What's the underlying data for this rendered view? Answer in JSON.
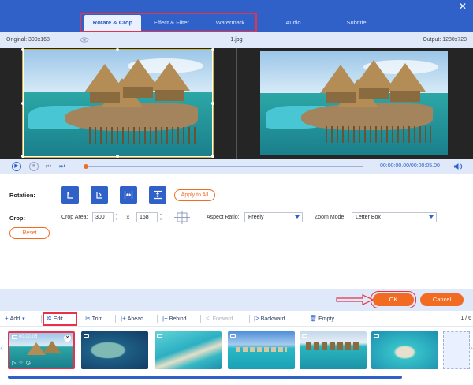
{
  "tabs": [
    {
      "label": "Rotate & Crop",
      "active": true
    },
    {
      "label": "Effect & Filter",
      "active": false
    },
    {
      "label": "Watermark",
      "active": false
    },
    {
      "label": "Audio",
      "active": false
    },
    {
      "label": "Subtitle",
      "active": false
    }
  ],
  "info": {
    "original": "Original: 300x168",
    "file_name": "1.jpg",
    "output": "Output: 1280x720"
  },
  "playback": {
    "time": "00:00:00.00/00:00:05.00"
  },
  "rotation": {
    "label": "Rotation:",
    "apply_all": "Apply to All"
  },
  "crop": {
    "label": "Crop:",
    "area_label": "Crop Area:",
    "width": "300",
    "times": "×",
    "height": "168",
    "aspect_label": "Aspect Ratio:",
    "aspect_value": "Freely",
    "zoom_label": "Zoom Mode:",
    "zoom_value": "Letter Box",
    "reset": "Reset"
  },
  "actions": {
    "ok": "OK",
    "cancel": "Cancel"
  },
  "toolbar": {
    "add": "Add",
    "edit": "Edit",
    "trim": "Trim",
    "ahead": "Ahead",
    "behind": "Behind",
    "forward": "Forward",
    "backward": "Backward",
    "empty": "Empty",
    "page": "1 / 6"
  },
  "thumbnail": {
    "time": "00:00:05"
  },
  "colors": {
    "brand_blue": "#2f61c9",
    "accent_orange": "#f26b22",
    "highlight_red": "#e8324a"
  }
}
